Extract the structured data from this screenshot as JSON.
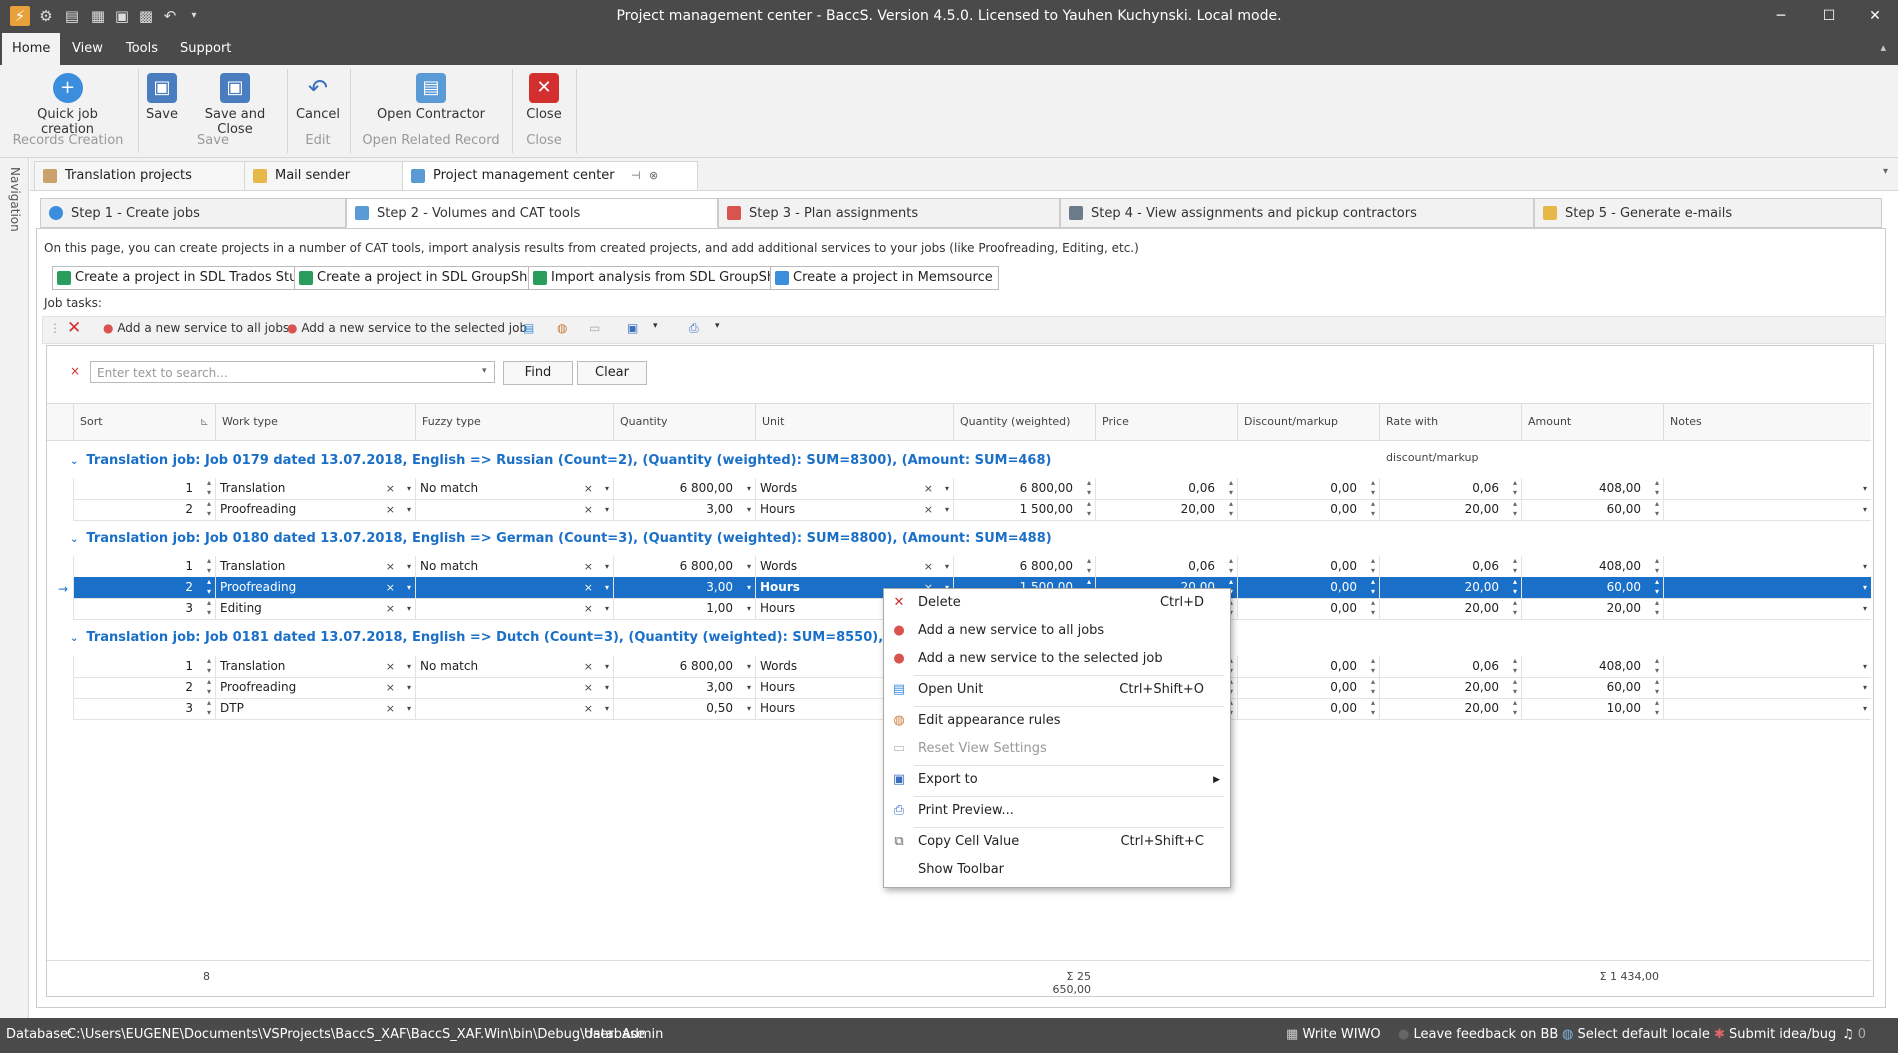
{
  "window": {
    "title": "Project management center - BaccS. Version 4.5.0. Licensed to Yauhen Kuchynski. Local mode."
  },
  "menu": [
    "Home",
    "View",
    "Tools",
    "Support"
  ],
  "ribbon": {
    "buttons": {
      "quick_job": "Quick job creation",
      "save": "Save",
      "save_close": "Save and Close",
      "cancel": "Cancel",
      "open_contractor": "Open Contractor",
      "close": "Close"
    },
    "groups": {
      "records": "Records Creation",
      "save": "Save",
      "edit": "Edit",
      "open_related": "Open Related Record",
      "close": "Close"
    }
  },
  "navigation_label": "Navigation",
  "doc_tabs": [
    "Translation projects",
    "Mail sender",
    "Project management center"
  ],
  "step_tabs": [
    "Step 1 - Create jobs",
    "Step 2 - Volumes and CAT tools",
    "Step 3 - Plan assignments",
    "Step 4 - View assignments and pickup contractors",
    "Step 5 - Generate e-mails"
  ],
  "description": "On this page, you can create projects in a number of CAT tools, import analysis results from created projects, and add additional services to your jobs (like Proofreading, Editing, etc.)",
  "cat_buttons": [
    "Create a project in SDL Trados Studio",
    "Create a project in SDL GroupShare",
    "Import analysis from SDL GroupShare",
    "Create a project in Memsource"
  ],
  "job_tasks_label": "Job tasks:",
  "grid_toolbar": {
    "add_all": "Add a new service to all jobs",
    "add_selected": "Add a new service to the selected job"
  },
  "search": {
    "placeholder": "Enter text to search...",
    "find": "Find",
    "clear": "Clear"
  },
  "columns": [
    "Sort",
    "Work type",
    "Fuzzy type",
    "Quantity",
    "Unit",
    "Quantity (weighted)",
    "Price",
    "Discount/markup",
    "Rate with discount/markup",
    "Amount",
    "Notes"
  ],
  "groups": [
    {
      "title": "Translation job: Job 0179 dated 13.07.2018, English => Russian (Count=2), (Quantity (weighted): SUM=8300), (Amount: SUM=468)",
      "rows": [
        {
          "sort": "1",
          "work": "Translation",
          "fuzzy": "No match",
          "qty": "6 800,00",
          "unit": "Words",
          "qtyw": "6 800,00",
          "price": "0,06",
          "disc": "0,00",
          "rate": "0,06",
          "amount": "408,00"
        },
        {
          "sort": "2",
          "work": "Proofreading",
          "fuzzy": "",
          "qty": "3,00",
          "unit": "Hours",
          "qtyw": "1 500,00",
          "price": "20,00",
          "disc": "0,00",
          "rate": "20,00",
          "amount": "60,00"
        }
      ]
    },
    {
      "title": "Translation job: Job 0180 dated 13.07.2018, English => German (Count=3), (Quantity (weighted): SUM=8800), (Amount: SUM=488)",
      "rows": [
        {
          "sort": "1",
          "work": "Translation",
          "fuzzy": "No match",
          "qty": "6 800,00",
          "unit": "Words",
          "qtyw": "6 800,00",
          "price": "0,06",
          "disc": "0,00",
          "rate": "0,06",
          "amount": "408,00"
        },
        {
          "sort": "2",
          "work": "Proofreading",
          "fuzzy": "",
          "qty": "3,00",
          "unit": "Hours",
          "qtyw": "1 500,00",
          "price": "20,00",
          "disc": "0,00",
          "rate": "20,00",
          "amount": "60,00"
        },
        {
          "sort": "3",
          "work": "Editing",
          "fuzzy": "",
          "qty": "1,00",
          "unit": "Hours",
          "qtyw": "",
          "price": "",
          "disc": "0,00",
          "rate": "20,00",
          "amount": "20,00"
        }
      ]
    },
    {
      "title": "Translation job: Job 0181 dated 13.07.2018, English => Dutch (Count=3), (Quantity (weighted): SUM=8550), (Amount:",
      "rows": [
        {
          "sort": "1",
          "work": "Translation",
          "fuzzy": "No match",
          "qty": "6 800,00",
          "unit": "Words",
          "qtyw": "",
          "price": "",
          "disc": "0,00",
          "rate": "0,06",
          "amount": "408,00"
        },
        {
          "sort": "2",
          "work": "Proofreading",
          "fuzzy": "",
          "qty": "3,00",
          "unit": "Hours",
          "qtyw": "",
          "price": "",
          "disc": "0,00",
          "rate": "20,00",
          "amount": "60,00"
        },
        {
          "sort": "3",
          "work": "DTP",
          "fuzzy": "",
          "qty": "0,50",
          "unit": "Hours",
          "qtyw": "",
          "price": "",
          "disc": "0,00",
          "rate": "20,00",
          "amount": "10,00"
        }
      ]
    }
  ],
  "footer": {
    "count": "8",
    "qty_sum": "Σ 25 650,00",
    "amount_sum": "Σ 1 434,00"
  },
  "context_menu": [
    {
      "label": "Delete",
      "shortcut": "Ctrl+D",
      "icon": "delete-icon",
      "disabled": false
    },
    {
      "label": "Add a new service to all jobs",
      "shortcut": "",
      "icon": "add-service-icon",
      "disabled": false
    },
    {
      "label": "Add a new service to the selected job",
      "shortcut": "",
      "icon": "add-service-icon",
      "disabled": false
    },
    {
      "label": "Open Unit",
      "shortcut": "Ctrl+Shift+O",
      "icon": "open-icon",
      "disabled": false
    },
    {
      "label": "Edit appearance rules",
      "shortcut": "",
      "icon": "palette-icon",
      "disabled": false
    },
    {
      "label": "Reset View Settings",
      "shortcut": "",
      "icon": "reset-icon",
      "disabled": true
    },
    {
      "label": "Export to",
      "shortcut": "",
      "icon": "export-icon",
      "disabled": false
    },
    {
      "label": "Print Preview...",
      "shortcut": "",
      "icon": "print-icon",
      "disabled": false
    },
    {
      "label": "Copy Cell Value",
      "shortcut": "Ctrl+Shift+C",
      "icon": "copy-icon",
      "disabled": false
    },
    {
      "label": "Show Toolbar",
      "shortcut": "",
      "icon": "",
      "disabled": false
    }
  ],
  "status": {
    "database_label": "Database:",
    "database_path": "C:\\Users\\EUGENE\\Documents\\VSProjects\\BaccS_XAF\\BaccS_XAF.Win\\bin\\Debug\\database",
    "user": "User: Admin",
    "write_wiwo": "Write WIWO",
    "feedback": "Leave feedback on BB",
    "locale": "Select default locale",
    "idea": "Submit idea/bug",
    "notif_count": "0"
  },
  "colors": {
    "accent": "#1a6fc8",
    "chrome": "#4a4a4a",
    "delete": "#d32f2f"
  }
}
